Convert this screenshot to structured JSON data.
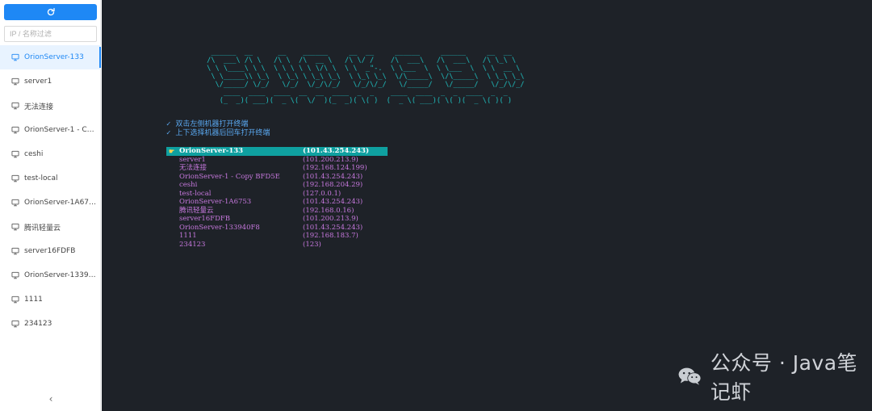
{
  "sidebar": {
    "refresh_icon": "refresh-icon",
    "filter_placeholder": "IP / 名称过滤",
    "collapse_icon": "chevron-left-icon",
    "collapse_glyph": "‹",
    "items": [
      {
        "label": "OrionServer-133",
        "active": true
      },
      {
        "label": "server1"
      },
      {
        "label": "无法连接"
      },
      {
        "label": "OrionServer-1 - Cop..."
      },
      {
        "label": "ceshi"
      },
      {
        "label": "test-local"
      },
      {
        "label": "OrionServer-1A6753"
      },
      {
        "label": "腾讯轻量云"
      },
      {
        "label": "server16FDFB"
      },
      {
        "label": "OrionServer-133940..."
      },
      {
        "label": "1111"
      },
      {
        "label": "234123"
      }
    ]
  },
  "terminal": {
    "banner_lines": [
      "  ______  __      __    ______     __  __     ______     ______     __  __    ",
      " /\\  ___\\ /\\ \\   /\\ \\  /\\  __ \\   /\\ \\/ /    /\\  ___\\   /\\  ___\\   /\\ \\_\\ \\   ",
      " \\ \\ \\____\\ \\ \\  \\ \\ \\ \\ \\ \\/\\ \\  \\ \\  _\"-.  \\ \\___  \\  \\ \\___  \\  \\ \\  __ \\  ",
      "  \\ \\_____\\\\ \\_\\  \\ \\_\\ \\ \\_\\ \\_\\  \\ \\_\\ \\_\\  \\/\\_____\\  \\/\\_____\\  \\ \\_\\ \\_\\ ",
      "   \\/_____/ \\/_/   \\/_/  \\/_/\\/_/   \\/_/\\/_/   \\/_____/   \\/_____/   \\/_/\\/_/ ",
      "     ____  ____  ____  __  __  ____  _  _    ____  ____  _  _  ____  _  _     ",
      "    (_  _)( ___)(  _ \\(  \\/  )(_  _)( \\( )  (  _ \\( ___)( \\( )(  _ \\( )( )    "
    ],
    "tips": [
      "双击左侧机器打开终端",
      "上下选择机器后回车打开终端"
    ],
    "check_glyph": "✓",
    "pointer_glyph": "☛",
    "servers": [
      {
        "name": "OrionServer-133",
        "ip": "(101.43.254.243)",
        "selected": true
      },
      {
        "name": "server1",
        "ip": "(101.200.213.9)"
      },
      {
        "name": "无法连接",
        "ip": "(192.168.124.199)"
      },
      {
        "name": "OrionServer-1 - Copy BFD5E",
        "ip": "(101.43.254.243)"
      },
      {
        "name": "ceshi",
        "ip": "(192.168.204.29)"
      },
      {
        "name": "test-local",
        "ip": "(127.0.0.1)"
      },
      {
        "name": "OrionServer-1A6753",
        "ip": "(101.43.254.243)"
      },
      {
        "name": "腾讯轻量云",
        "ip": "(192.168.0.16)"
      },
      {
        "name": "server16FDFB",
        "ip": "(101.200.213.9)"
      },
      {
        "name": "OrionServer-133940F8",
        "ip": "(101.43.254.243)"
      },
      {
        "name": "1111",
        "ip": "(192.168.183.7)"
      },
      {
        "name": "234123",
        "ip": "(123)"
      }
    ]
  },
  "watermark": {
    "icon": "wechat-icon",
    "text": "公众号 · Java笔记虾"
  },
  "colors": {
    "accent": "#1e88f5",
    "terminal_bg": "#1e2228",
    "banner": "#1fc3c3",
    "tips": "#5aa8f0",
    "server_text": "#c678dd",
    "selection_bg": "#0fa0a0"
  }
}
